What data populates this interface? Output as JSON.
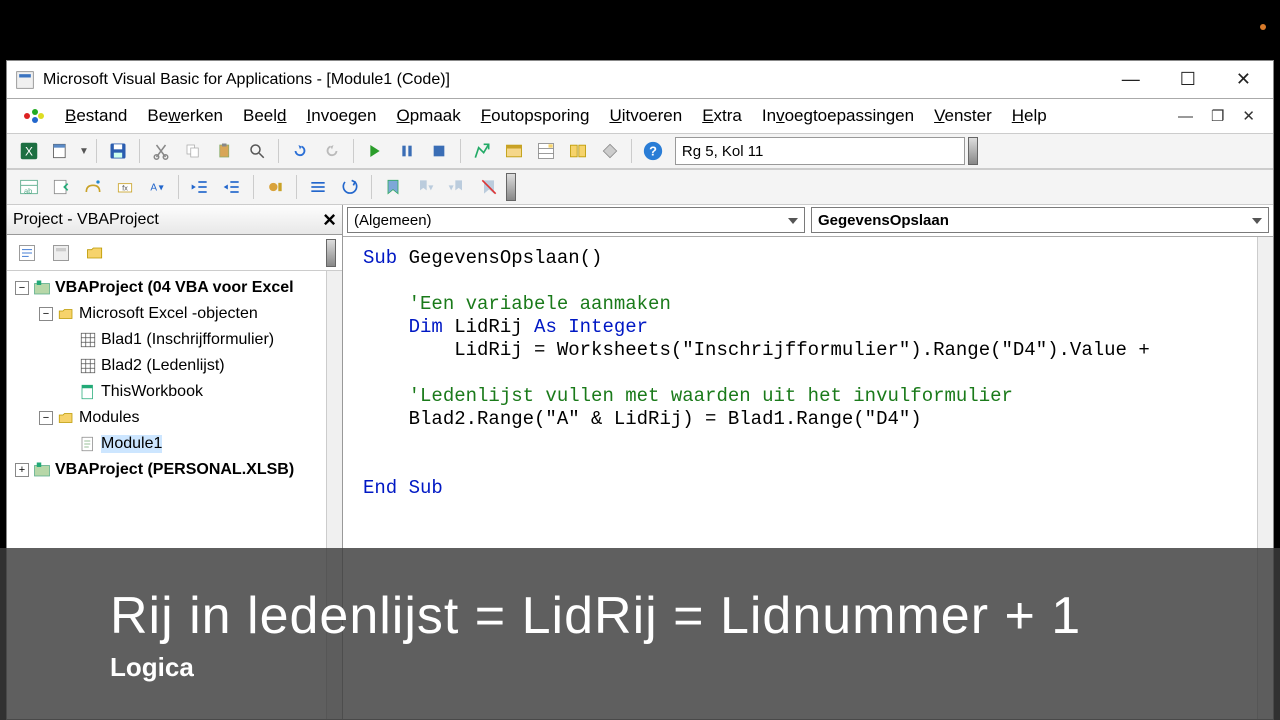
{
  "window": {
    "title": "Microsoft Visual Basic for Applications - [Module1 (Code)]"
  },
  "menu": {
    "items": [
      "Bestand",
      "Bewerken",
      "Beeld",
      "Invoegen",
      "Opmaak",
      "Foutopsporing",
      "Uitvoeren",
      "Extra",
      "Invoegtoepassingen",
      "Venster",
      "Help"
    ]
  },
  "toolbar": {
    "position_display": "Rg 5, Kol 11"
  },
  "project_pane": {
    "title": "Project - VBAProject",
    "root1": "VBAProject (04 VBA voor Excel",
    "excel_objects": "Microsoft Excel -objecten",
    "sheet1": "Blad1 (Inschrijfformulier)",
    "sheet2": "Blad2 (Ledenlijst)",
    "thiswb": "ThisWorkbook",
    "modules_folder": "Modules",
    "module1": "Module1",
    "root2": "VBAProject (PERSONAL.XLSB)"
  },
  "code_dropdowns": {
    "scope": "(Algemeen)",
    "proc": "GegevensOpslaan"
  },
  "code": {
    "l1_a": "Sub",
    "l1_b": " GegevensOpslaan()",
    "l3_a": "    'Een variabele aanmaken",
    "l4_a": "    ",
    "l4_b": "Dim",
    "l4_c": " LidRij ",
    "l4_d": "As Integer",
    "l5_a": "        LidRij = Worksheets(\"Inschrijfformulier\").Range(\"D4\").Value + ",
    "l7_a": "    'Ledenlijst vullen met waarden uit het invulformulier",
    "l8_a": "    Blad2.Range(\"A\" & LidRij) = Blad1.Range(\"D4\")",
    "l10_a": "End Sub"
  },
  "overlay": {
    "title": "Rij in ledenlijst = LidRij = Lidnummer + 1",
    "sub": "Logica"
  }
}
